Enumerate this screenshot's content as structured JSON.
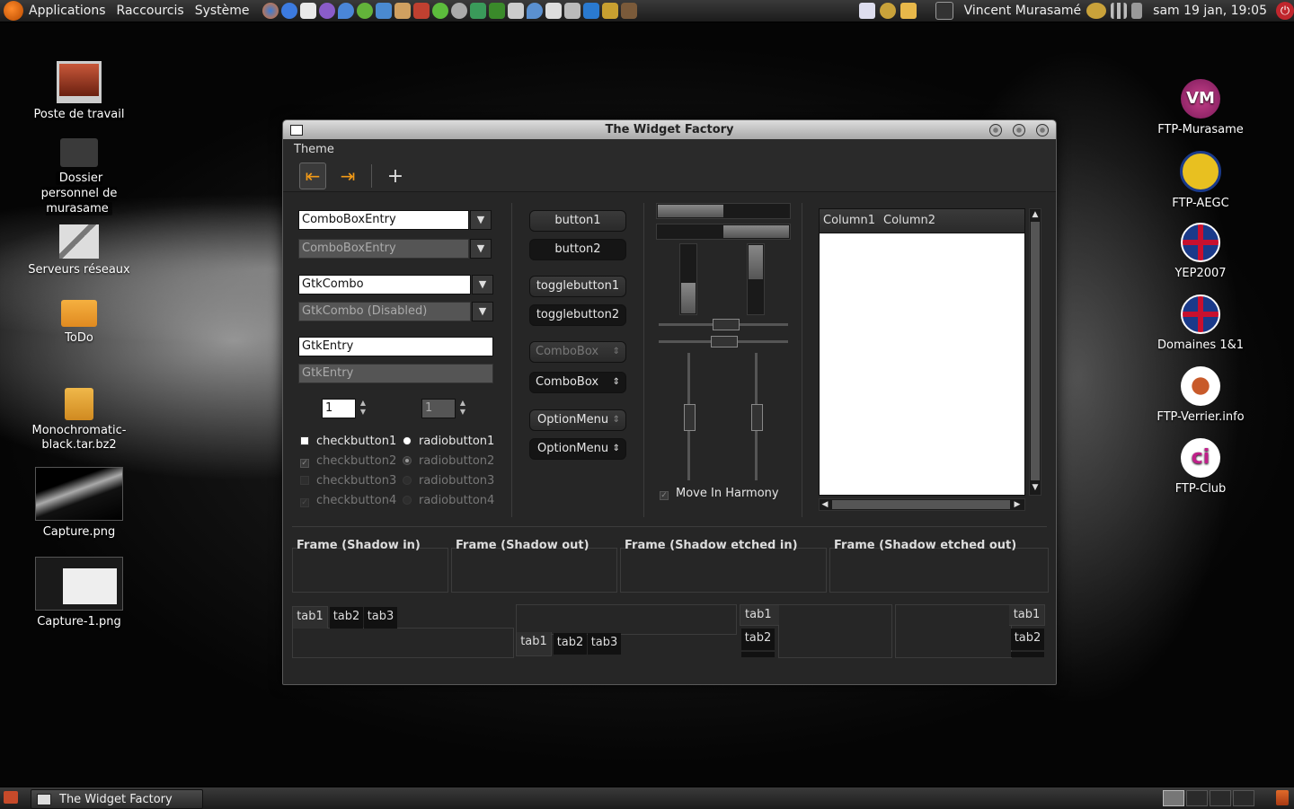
{
  "top_panel": {
    "menus": [
      "Applications",
      "Raccourcis",
      "Système"
    ],
    "user": "Vincent Murasamé",
    "clock": "sam 19 jan, 19:05"
  },
  "desktop_icons_left": [
    {
      "label": "Poste de travail"
    },
    {
      "label": "Dossier personnel de murasame"
    },
    {
      "label": "Serveurs réseaux"
    },
    {
      "label": "ToDo"
    },
    {
      "label": "Monochromatic-black.tar.bz2"
    },
    {
      "label": "Capture.png"
    },
    {
      "label": "Capture-1.png"
    }
  ],
  "desktop_icons_right": [
    {
      "label": "FTP-Murasame",
      "badge": "VM"
    },
    {
      "label": "FTP-AEGC"
    },
    {
      "label": "YEP2007"
    },
    {
      "label": "Domaines 1&1"
    },
    {
      "label": "FTP-Verrier.info"
    },
    {
      "label": "FTP-Club",
      "badge": "ci"
    }
  ],
  "window": {
    "title": "The Widget Factory",
    "menu": "Theme",
    "combos": {
      "combo_entry_1": "ComboBoxEntry",
      "combo_entry_2": "ComboBoxEntry",
      "gtk_combo": "GtkCombo",
      "gtk_combo_disabled": "GtkCombo (Disabled)",
      "entry_1": "GtkEntry",
      "entry_2": "GtkEntry",
      "spin_1": "1",
      "spin_2": "1"
    },
    "checks": [
      "checkbutton1",
      "checkbutton2",
      "checkbutton3",
      "checkbutton4"
    ],
    "radios": [
      "radiobutton1",
      "radiobutton2",
      "radiobutton3",
      "radiobutton4"
    ],
    "buttons": {
      "button1": "button1",
      "button2": "button2",
      "toggle1": "togglebutton1",
      "toggle2": "togglebutton2",
      "combobox1": "ComboBox",
      "combobox2": "ComboBox",
      "option1": "OptionMenu",
      "option2": "OptionMenu"
    },
    "progress": {
      "horizontal_1": 0.5,
      "horizontal_2": 0.5,
      "vertical_1": 0.45,
      "vertical_2": 0.5
    },
    "move_in_harmony": "Move In Harmony",
    "tree_columns": [
      "Column1",
      "Column2"
    ],
    "frames": [
      "Frame (Shadow in)",
      "Frame (Shadow out)",
      "Frame (Shadow etched in)",
      "Frame (Shadow etched out)"
    ],
    "tabs": [
      "tab1",
      "tab2",
      "tab3"
    ]
  },
  "taskbar": {
    "window_title": "The Widget Factory"
  }
}
